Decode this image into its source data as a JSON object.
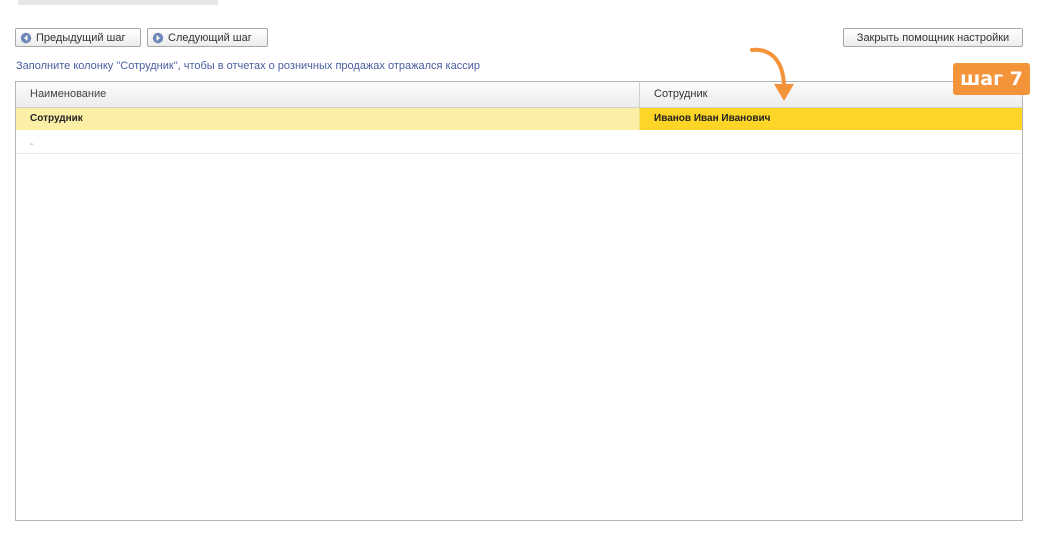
{
  "toolbar": {
    "prev_label": "Предыдущий шаг",
    "next_label": "Следующий шаг",
    "close_label": "Закрыть помощник настройки",
    "prev_icon": "arrow-left-icon",
    "next_icon": "arrow-right-icon"
  },
  "hint": "Заполните колонку \"Сотрудник\", чтобы в отчетах о розничных продажах отражался кассир",
  "table": {
    "columns": [
      "Наименование",
      "Сотрудник"
    ],
    "rows": [
      {
        "name": "Сотрудник",
        "employee": "Иванов Иван Иванович",
        "selected": true
      },
      {
        "name": "-",
        "employee": ""
      }
    ]
  },
  "annotation": {
    "step_label": "шаг 7",
    "color": "#f3933a"
  },
  "colors": {
    "selected_row": "#fbefa6",
    "selected_cell": "#fcd526",
    "hint_text": "#4a5ea0"
  }
}
